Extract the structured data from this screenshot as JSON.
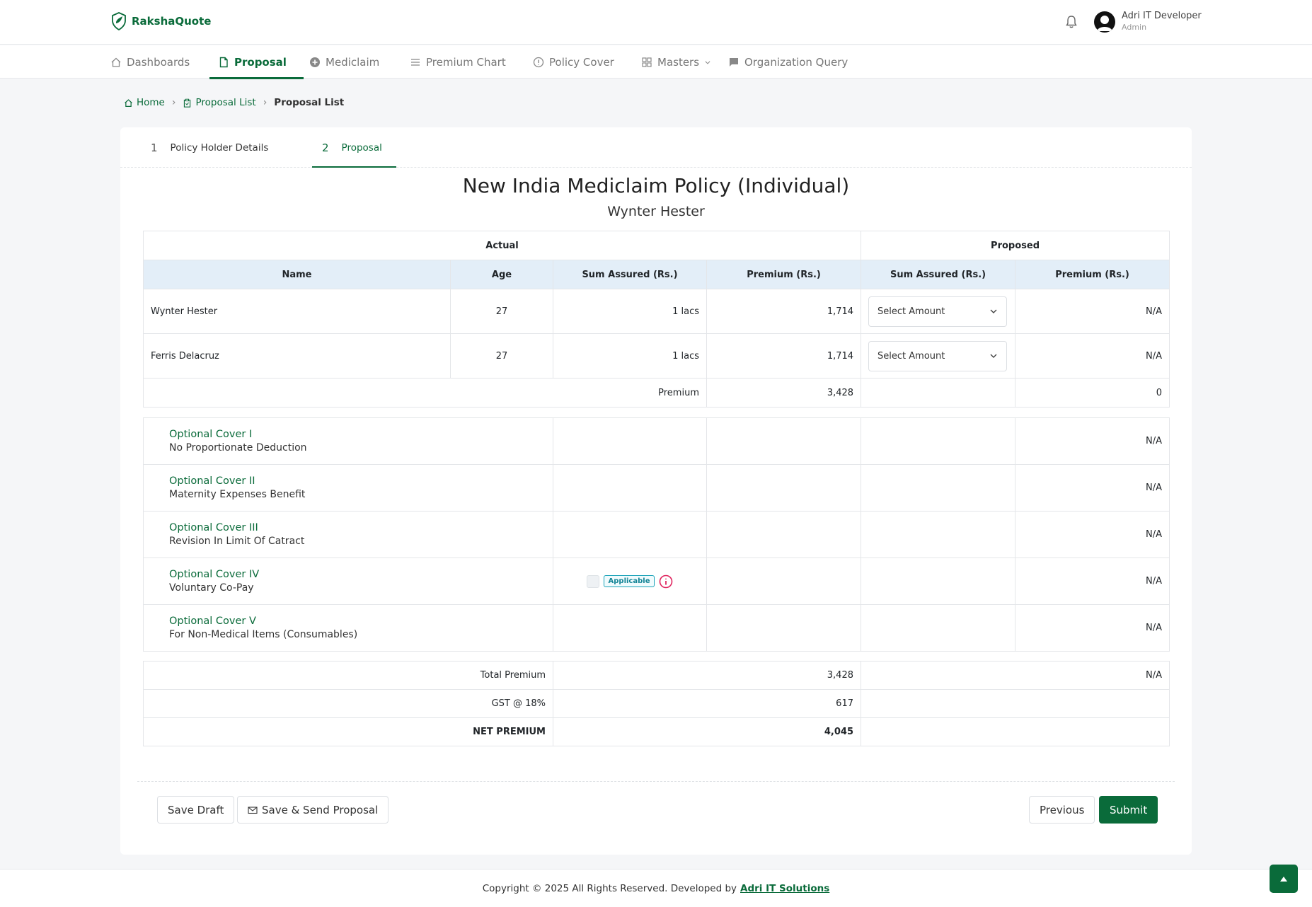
{
  "brand": {
    "name": "RakshaQuote"
  },
  "user": {
    "name": "Adri IT Developer",
    "role": "Admin"
  },
  "nav": {
    "items": [
      {
        "label": "Dashboards"
      },
      {
        "label": "Proposal"
      },
      {
        "label": "Mediclaim"
      },
      {
        "label": "Premium Chart"
      },
      {
        "label": "Policy Cover"
      },
      {
        "label": "Masters"
      },
      {
        "label": "Organization Query"
      }
    ]
  },
  "breadcrumb": {
    "home": "Home",
    "list": "Proposal List",
    "current": "Proposal List"
  },
  "steps": [
    {
      "num": "1",
      "label": "Policy Holder Details"
    },
    {
      "num": "2",
      "label": "Proposal"
    }
  ],
  "policy": {
    "title": "New India Mediclaim Policy (Individual)",
    "holder": "Wynter Hester"
  },
  "table": {
    "group_actual": "Actual",
    "group_proposed": "Proposed",
    "headers": [
      "Name",
      "Age",
      "Sum Assured (Rs.)",
      "Premium (Rs.)",
      "Sum Assured (Rs.)",
      "Premium (Rs.)"
    ],
    "rows": [
      {
        "name": "Wynter Hester",
        "age": "27",
        "sum": "1 lacs",
        "premium": "1,714",
        "select": "Select Amount",
        "proposed_premium": "N/A"
      },
      {
        "name": "Ferris Delacruz",
        "age": "27",
        "sum": "1 lacs",
        "premium": "1,714",
        "select": "Select Amount",
        "proposed_premium": "N/A"
      }
    ],
    "premium_label": "Premium",
    "premium_actual": "3,428",
    "premium_proposed": "0"
  },
  "covers": [
    {
      "name": "Optional Cover I",
      "desc": "No Proportionate Deduction",
      "value": "N/A"
    },
    {
      "name": "Optional Cover II",
      "desc": "Maternity Expenses Benefit",
      "value": "N/A"
    },
    {
      "name": "Optional Cover III",
      "desc": "Revision In Limit Of Catract",
      "value": "N/A"
    },
    {
      "name": "Optional Cover IV",
      "desc": "Voluntary Co-Pay",
      "value": "N/A",
      "badge": "Applicable"
    },
    {
      "name": "Optional Cover V",
      "desc": "For Non-Medical Items (Consumables)",
      "value": "N/A"
    }
  ],
  "totals": {
    "total_label": "Total Premium",
    "total_actual": "3,428",
    "total_proposed": "N/A",
    "gst_label": "GST @ 18%",
    "gst_actual": "617",
    "net_label": "NET PREMIUM",
    "net_actual": "4,045"
  },
  "buttons": {
    "save_draft": "Save Draft",
    "save_send": "Save & Send Proposal",
    "previous": "Previous",
    "submit": "Submit"
  },
  "footer": {
    "text": "Copyright © 2025 All Rights Reserved. Developed by",
    "link": "Adri IT Solutions"
  },
  "colors": {
    "accent": "#0a6b3a",
    "header_bg": "#e3eef8",
    "info": "#e0245e",
    "badge": "#17a2b8"
  }
}
